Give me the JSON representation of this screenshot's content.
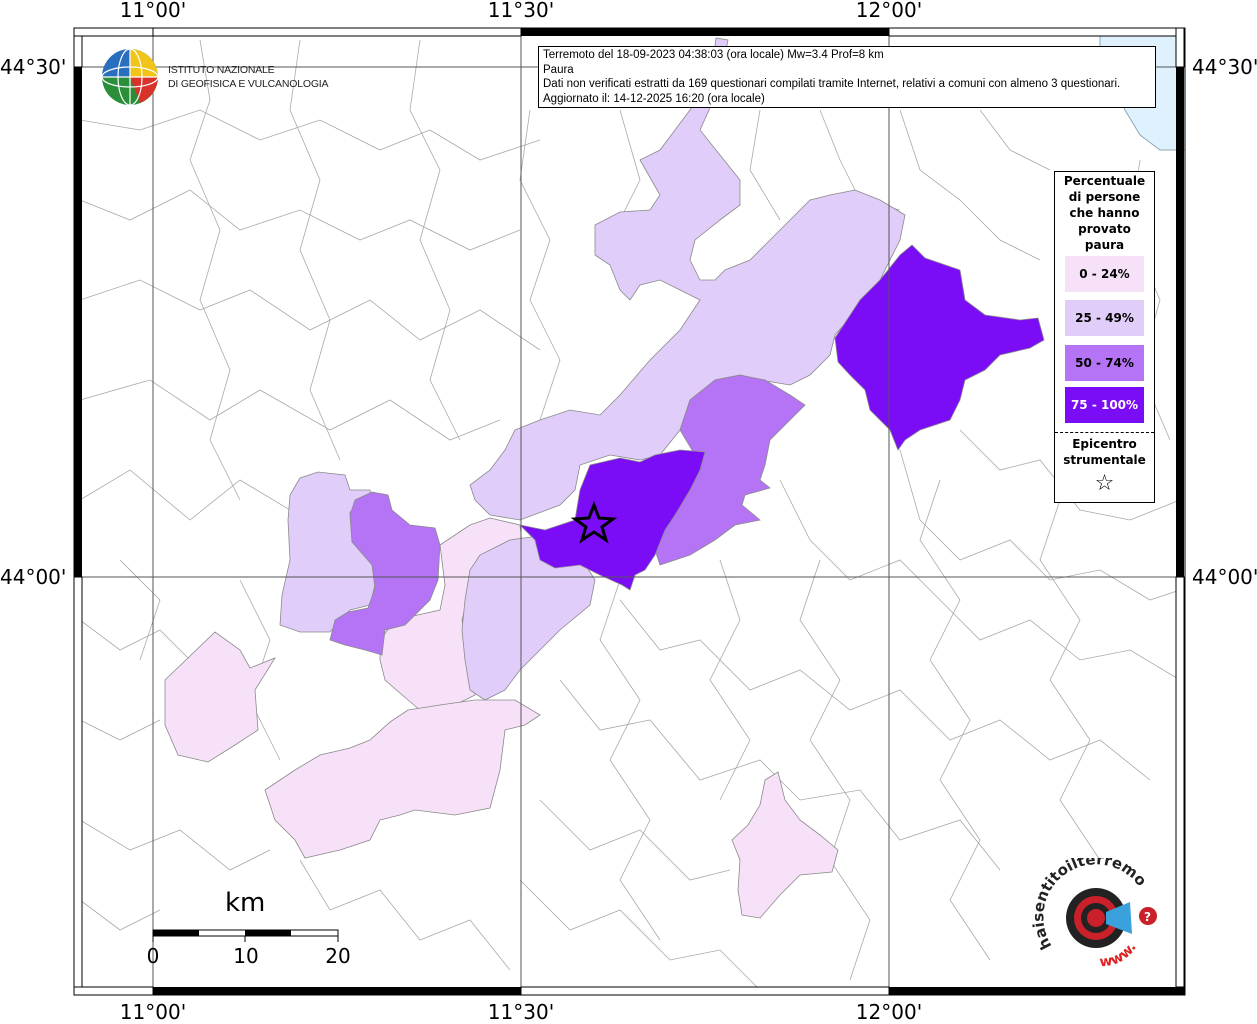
{
  "map": {
    "lon_labels": [
      "11°00'",
      "11°30'",
      "12°00'"
    ],
    "lat_labels": [
      "44°30'",
      "44°00'"
    ]
  },
  "header": {
    "logo_line1": "ISTITUTO NAZIONALE",
    "logo_line2": "DI GEOFISICA E VULCANOLOGIA"
  },
  "info": {
    "line1": "Terremoto del 18-09-2023 04:38:03 (ora locale) Mw=3.4 Prof=8 km",
    "line2": "Paura",
    "line3": "Dati non verificati estratti da 169 questionari compilati tramite Internet, relativi a comuni con almeno 3 questionari.",
    "line4": "Aggiornato il: 14-12-2025 16:20 (ora locale)"
  },
  "legend": {
    "title_lines": [
      "Percentuale",
      "di persone",
      "che hanno",
      "provato",
      "paura"
    ],
    "classes": [
      {
        "label": "0 - 24%",
        "color": "#f6e1f9"
      },
      {
        "label": "25 - 49%",
        "color": "#e0cdf9"
      },
      {
        "label": "50 - 74%",
        "color": "#b474f5"
      },
      {
        "label": "75 - 100%",
        "color": "#7b0cf6"
      }
    ],
    "epicenter_line1": "Epicentro",
    "epicenter_line2": "strumentale",
    "epicenter_symbol": "☆"
  },
  "scale": {
    "unit": "km",
    "ticks": [
      "0",
      "10",
      "20"
    ]
  },
  "logo_hse": {
    "text_main": "haisentitoilterremoto.it",
    "text_www": "www."
  },
  "colors": {
    "sea": "#dff1fc",
    "border": "#a9a9a9",
    "class0": "#f6e1f9",
    "class1": "#e0cdf9",
    "class2": "#b474f5",
    "class3": "#7b0cf6"
  }
}
